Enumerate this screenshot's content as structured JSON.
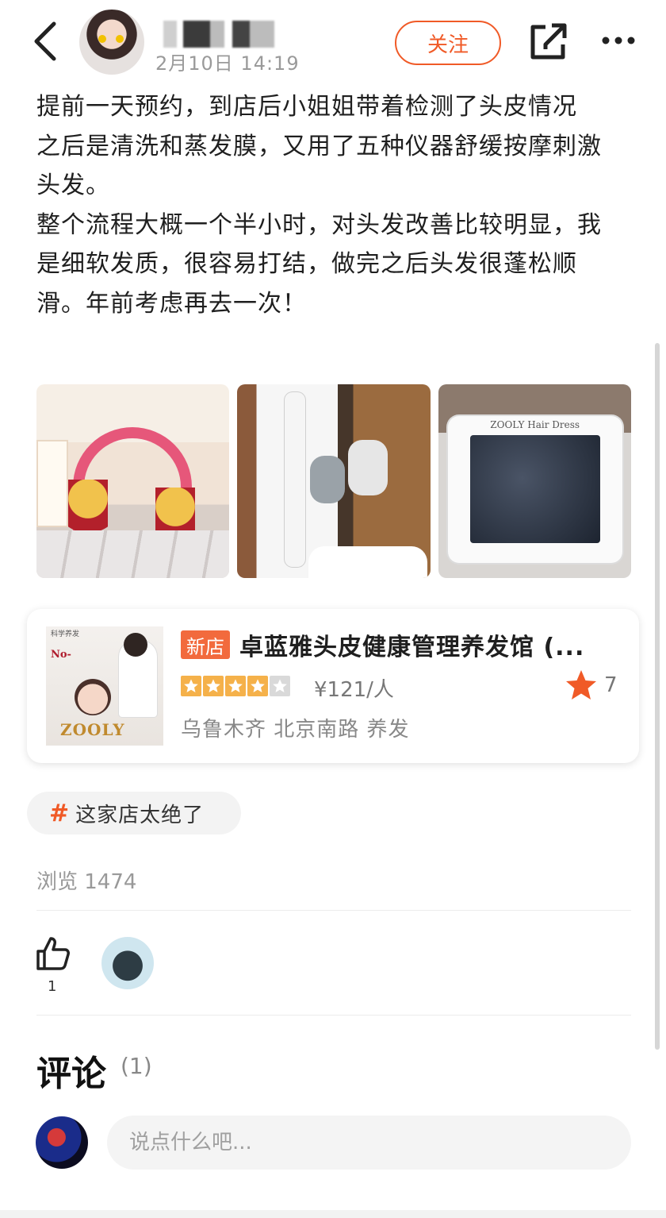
{
  "header": {
    "date_text": "2月10日 14:19",
    "follow_label": "关注"
  },
  "post": {
    "paragraphs": [
      "提前一天预约，到店后小姐姐带着检测了头皮情况",
      "之后是清洗和蒸发膜，又用了五种仪器舒缓按摩刺激头发。",
      "整个流程大概一个半小时，对头发改善比较明显，我是细软发质，很容易打结，做完之后头发很蓬松顺滑。年前考虑再去一次！"
    ],
    "photo_brand_text": "ZOOLY Hair Dress"
  },
  "shop": {
    "tag": "新店",
    "name": "卓蓝雅头皮健康管理养发馆 (...",
    "rating": 4,
    "rating_max": 5,
    "price": "¥121/人",
    "favorites": "7",
    "location": "乌鲁木齐 北京南路 养发",
    "thumb_caption": "科学养发",
    "thumb_no": "No-",
    "thumb_brand": "ZOOLY"
  },
  "topic": {
    "hash": "#",
    "label": "这家店太绝了"
  },
  "stats": {
    "views_label": "浏览 1474",
    "likes": "1"
  },
  "comments": {
    "title": "评论",
    "count": "(1)",
    "placeholder": "说点什么吧..."
  },
  "colors": {
    "accent": "#f05a27",
    "star": "#f5b14a",
    "new_tag": "#f26a3d"
  },
  "icons": [
    "back-arrow-icon",
    "share-icon",
    "more-icon",
    "thumbs-up-icon",
    "star-icon",
    "hashtag-icon"
  ]
}
